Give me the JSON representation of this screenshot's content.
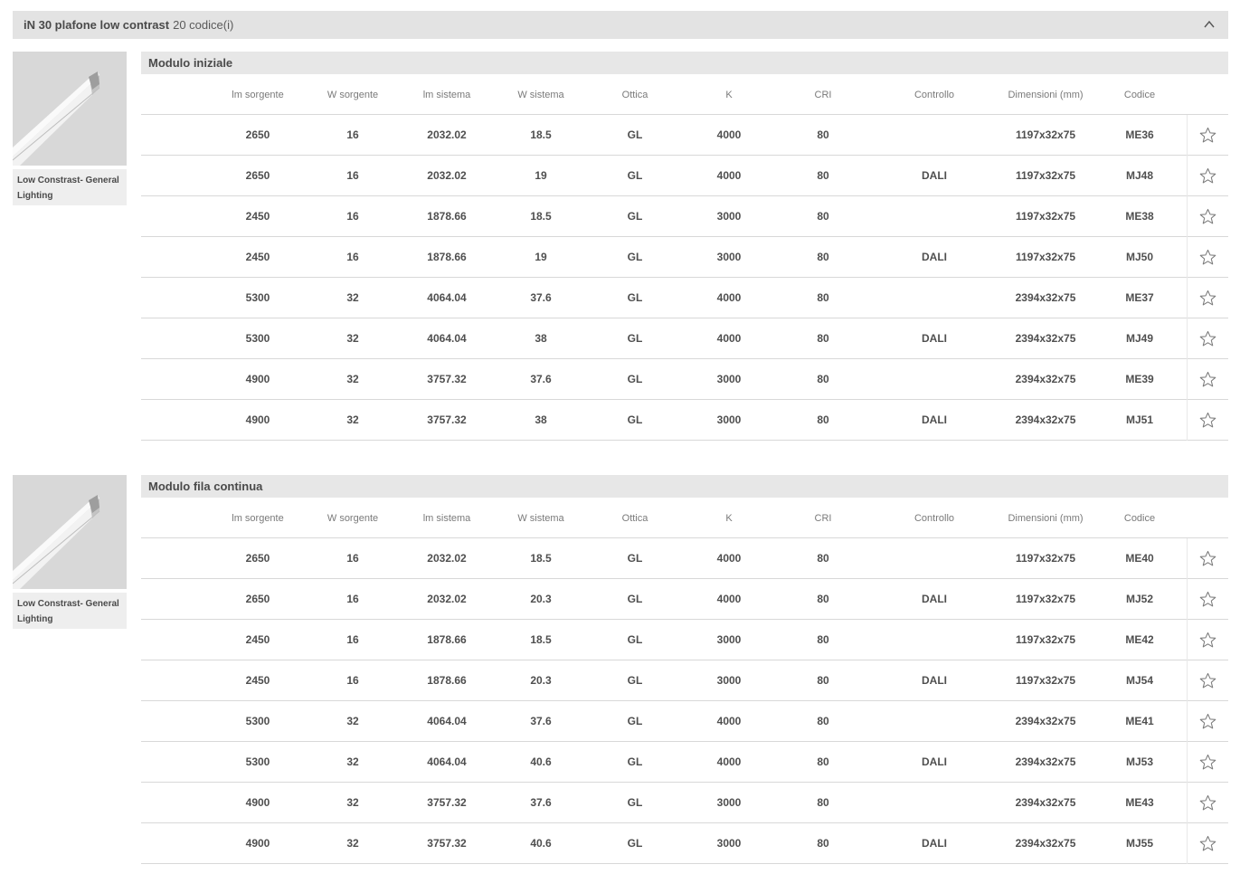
{
  "header": {
    "title": "iN 30 plafone low contrast",
    "count": "20 codice(i)",
    "collapse_icon": "chevron-up-icon"
  },
  "columns": [
    "lm sorgente",
    "W sorgente",
    "lm sistema",
    "W sistema",
    "Ottica",
    "K",
    "CRI",
    "Controllo",
    "Dimensioni (mm)",
    "Codice"
  ],
  "sections": [
    {
      "title": "Modulo iniziale",
      "product_caption": "Low Constrast- General Lighting",
      "rows": [
        [
          "2650",
          "16",
          "2032.02",
          "18.5",
          "GL",
          "4000",
          "80",
          "",
          "1197x32x75",
          "ME36"
        ],
        [
          "2650",
          "16",
          "2032.02",
          "19",
          "GL",
          "4000",
          "80",
          "DALI",
          "1197x32x75",
          "MJ48"
        ],
        [
          "2450",
          "16",
          "1878.66",
          "18.5",
          "GL",
          "3000",
          "80",
          "",
          "1197x32x75",
          "ME38"
        ],
        [
          "2450",
          "16",
          "1878.66",
          "19",
          "GL",
          "3000",
          "80",
          "DALI",
          "1197x32x75",
          "MJ50"
        ],
        [
          "5300",
          "32",
          "4064.04",
          "37.6",
          "GL",
          "4000",
          "80",
          "",
          "2394x32x75",
          "ME37"
        ],
        [
          "5300",
          "32",
          "4064.04",
          "38",
          "GL",
          "4000",
          "80",
          "DALI",
          "2394x32x75",
          "MJ49"
        ],
        [
          "4900",
          "32",
          "3757.32",
          "37.6",
          "GL",
          "3000",
          "80",
          "",
          "2394x32x75",
          "ME39"
        ],
        [
          "4900",
          "32",
          "3757.32",
          "38",
          "GL",
          "3000",
          "80",
          "DALI",
          "2394x32x75",
          "MJ51"
        ]
      ]
    },
    {
      "title": "Modulo fila continua",
      "product_caption": "Low Constrast- General Lighting",
      "rows": [
        [
          "2650",
          "16",
          "2032.02",
          "18.5",
          "GL",
          "4000",
          "80",
          "",
          "1197x32x75",
          "ME40"
        ],
        [
          "2650",
          "16",
          "2032.02",
          "20.3",
          "GL",
          "4000",
          "80",
          "DALI",
          "1197x32x75",
          "MJ52"
        ],
        [
          "2450",
          "16",
          "1878.66",
          "18.5",
          "GL",
          "3000",
          "80",
          "",
          "1197x32x75",
          "ME42"
        ],
        [
          "2450",
          "16",
          "1878.66",
          "20.3",
          "GL",
          "3000",
          "80",
          "DALI",
          "1197x32x75",
          "MJ54"
        ],
        [
          "5300",
          "32",
          "4064.04",
          "37.6",
          "GL",
          "4000",
          "80",
          "",
          "2394x32x75",
          "ME41"
        ],
        [
          "5300",
          "32",
          "4064.04",
          "40.6",
          "GL",
          "4000",
          "80",
          "DALI",
          "2394x32x75",
          "MJ53"
        ],
        [
          "4900",
          "32",
          "3757.32",
          "37.6",
          "GL",
          "3000",
          "80",
          "",
          "2394x32x75",
          "ME43"
        ],
        [
          "4900",
          "32",
          "3757.32",
          "40.6",
          "GL",
          "3000",
          "80",
          "DALI",
          "2394x32x75",
          "MJ55"
        ]
      ]
    }
  ]
}
